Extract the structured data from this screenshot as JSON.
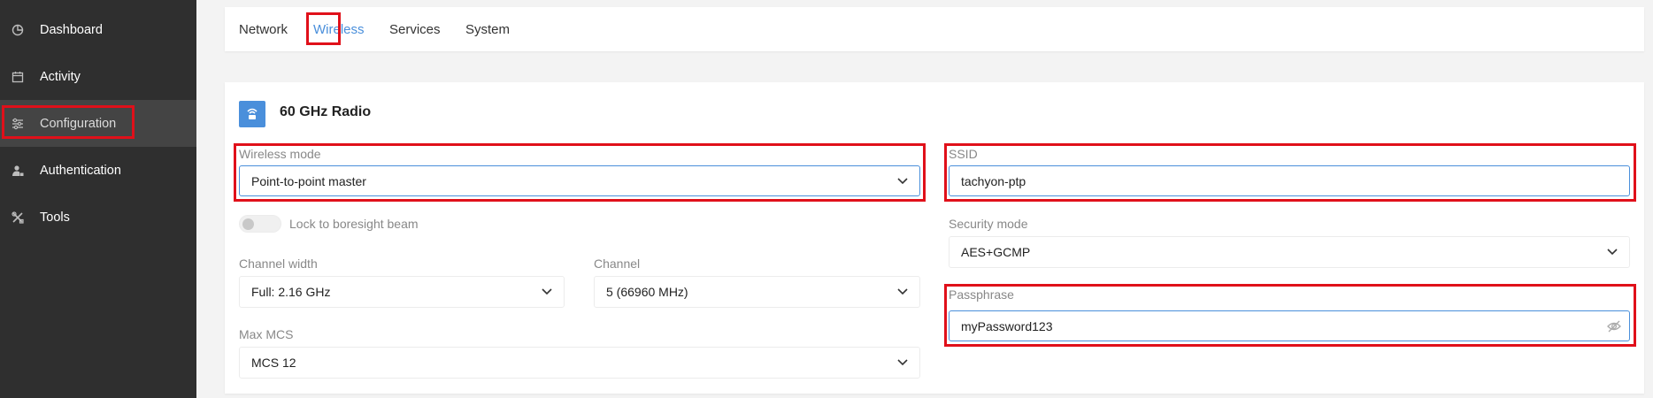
{
  "sidebar": {
    "items": [
      {
        "label": "Dashboard",
        "icon": "dashboard-pie-icon"
      },
      {
        "label": "Activity",
        "icon": "calendar-icon"
      },
      {
        "label": "Configuration",
        "icon": "sliders-icon",
        "active": true
      },
      {
        "label": "Authentication",
        "icon": "user-lock-icon"
      },
      {
        "label": "Tools",
        "icon": "tools-icon"
      }
    ]
  },
  "tabs": [
    {
      "label": "Network"
    },
    {
      "label": "Wireless",
      "active": true
    },
    {
      "label": "Services"
    },
    {
      "label": "System"
    }
  ],
  "section": {
    "title": "60 GHz Radio",
    "icon": "radio-router-icon"
  },
  "form": {
    "wireless_mode": {
      "label": "Wireless mode",
      "value": "Point-to-point master"
    },
    "lock_boresight": {
      "label": "Lock to boresight beam",
      "enabled": false
    },
    "channel_width": {
      "label": "Channel width",
      "value": "Full: 2.16 GHz"
    },
    "channel": {
      "label": "Channel",
      "value": "5 (66960 MHz)"
    },
    "max_mcs": {
      "label": "Max MCS",
      "value": "MCS 12"
    },
    "ssid": {
      "label": "SSID",
      "value": "tachyon-ptp"
    },
    "security_mode": {
      "label": "Security mode",
      "value": "AES+GCMP"
    },
    "passphrase": {
      "label": "Passphrase",
      "value": "myPassword123"
    }
  },
  "colors": {
    "accent": "#4a8fdb",
    "highlight": "#e0101a",
    "sidebar_bg": "#2f2f2f",
    "sidebar_active_bg": "#444444"
  }
}
